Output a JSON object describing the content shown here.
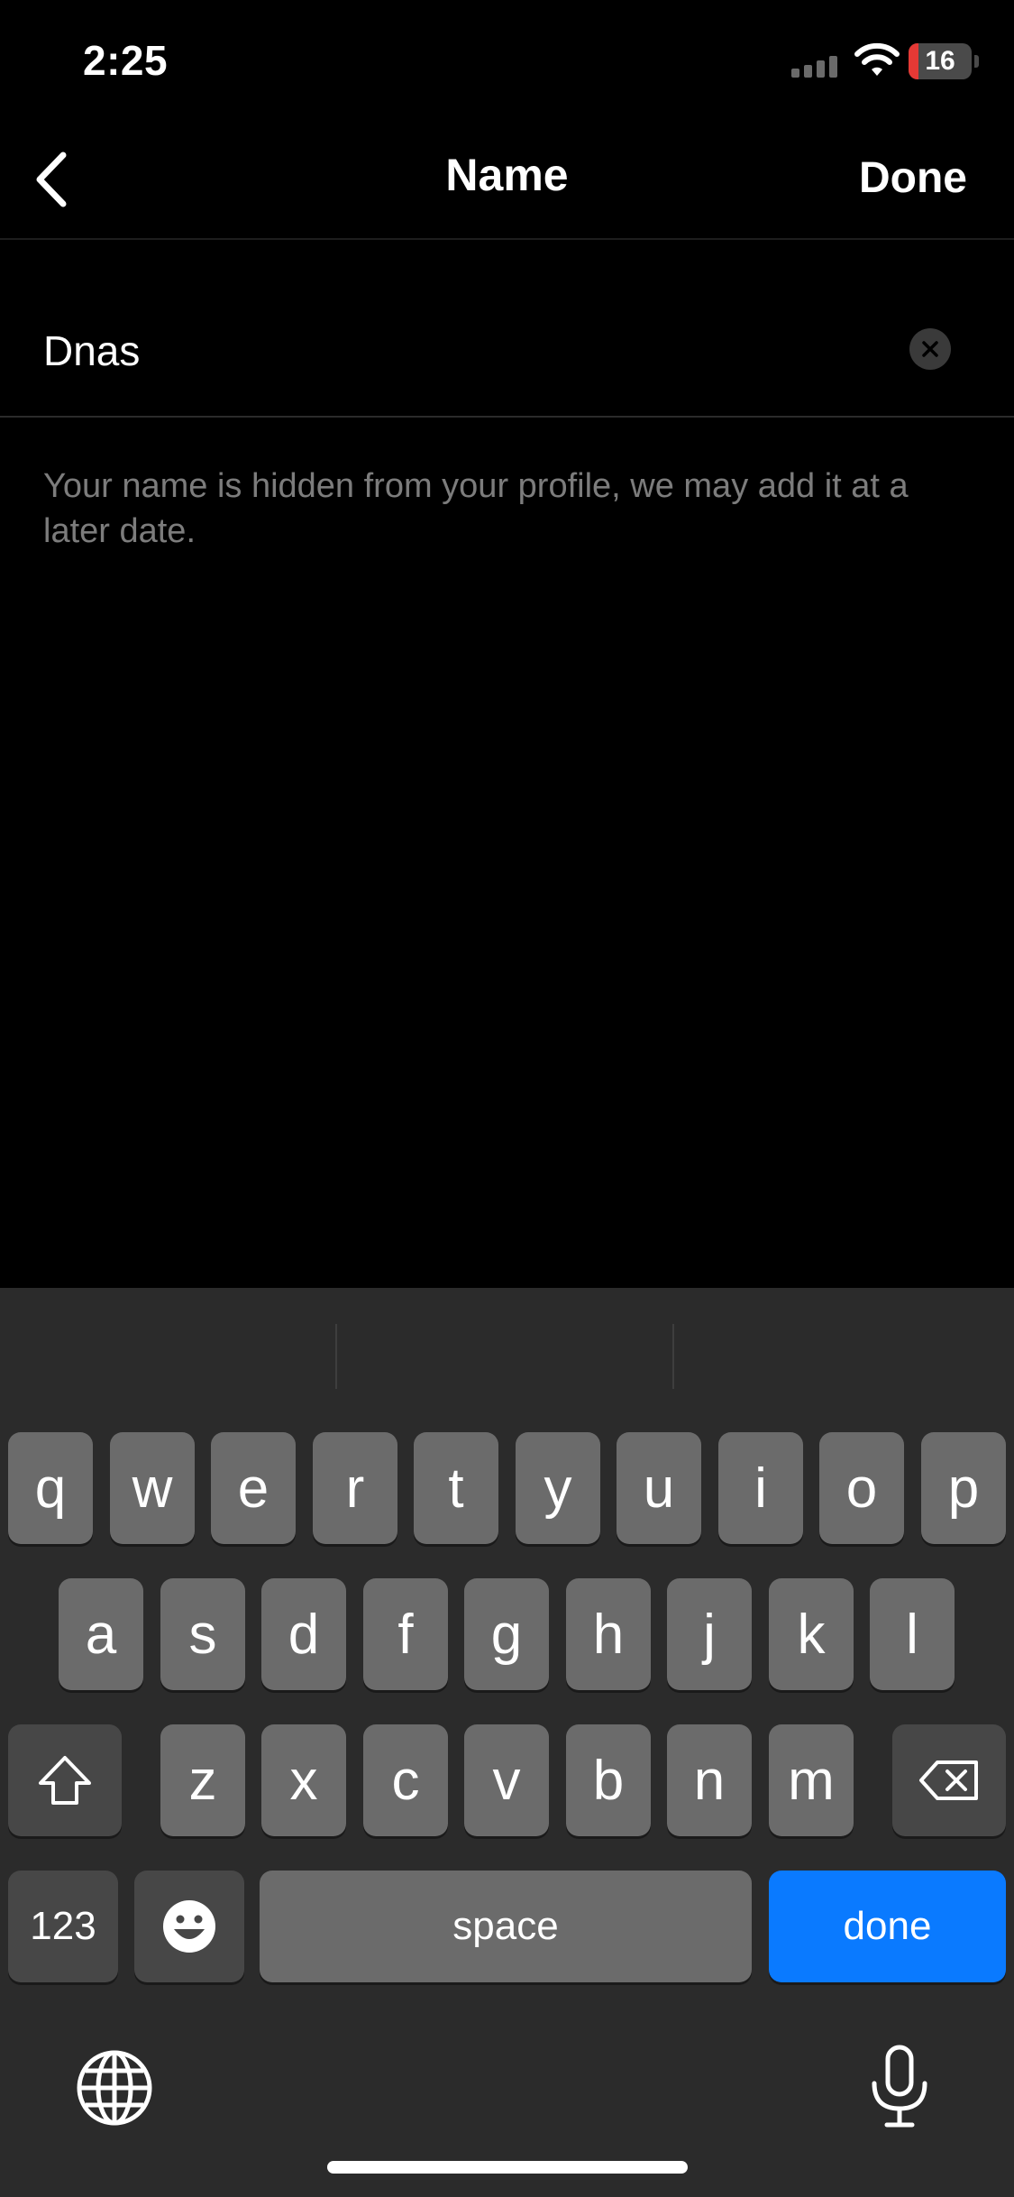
{
  "status_bar": {
    "time": "2:25",
    "battery_level": "16",
    "battery_fraction": 0.16,
    "battery_color": "#e53935"
  },
  "nav": {
    "title": "Name",
    "done_label": "Done",
    "back_icon": "chevron-left-icon"
  },
  "name_field": {
    "value": "Dnas",
    "clear_icon": "close-circle-icon"
  },
  "helper_text": "Your name is hidden from your profile, we may add it at a later date.",
  "keyboard": {
    "row1": [
      "q",
      "w",
      "e",
      "r",
      "t",
      "y",
      "u",
      "i",
      "o",
      "p"
    ],
    "row2": [
      "a",
      "s",
      "d",
      "f",
      "g",
      "h",
      "j",
      "k",
      "l"
    ],
    "row3": [
      "z",
      "x",
      "c",
      "v",
      "b",
      "n",
      "m"
    ],
    "numbers_label": "123",
    "space_label": "space",
    "done_label": "done",
    "accent_color": "#0a7aff",
    "icons": [
      "shift-icon",
      "backspace-icon",
      "emoji-icon",
      "globe-icon",
      "microphone-icon"
    ]
  }
}
